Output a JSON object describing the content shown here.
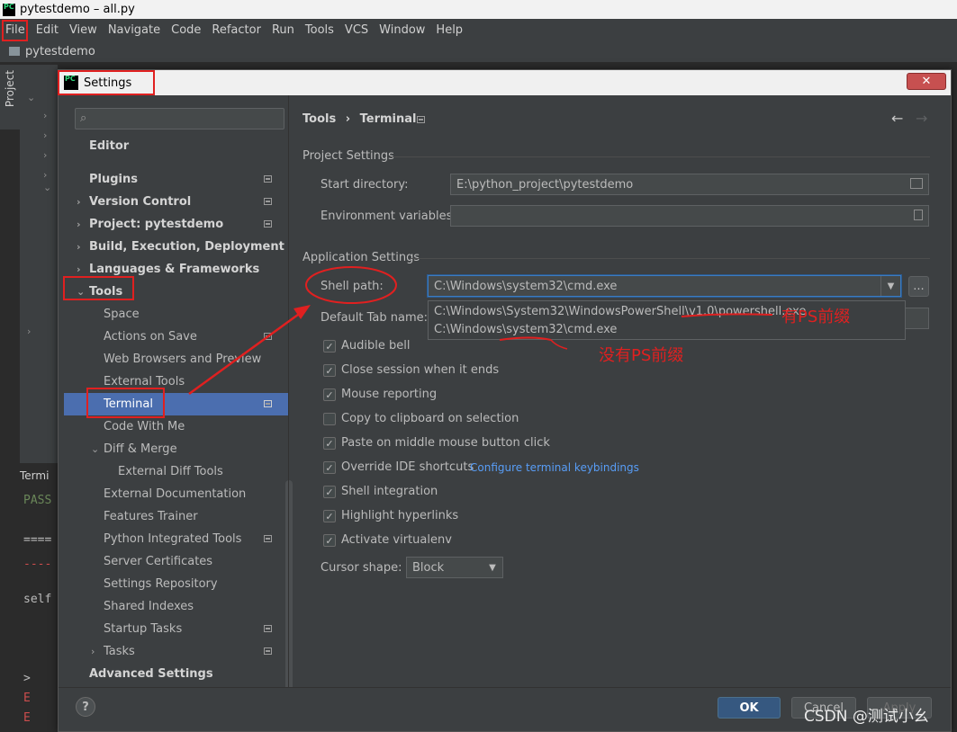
{
  "window": {
    "title": "pytestdemo – all.py",
    "logo": "PC"
  },
  "menu": [
    "File",
    "Edit",
    "View",
    "Navigate",
    "Code",
    "Refactor",
    "Run",
    "Tools",
    "VCS",
    "Window",
    "Help"
  ],
  "navbar": {
    "project": "pytestdemo"
  },
  "tool_window": {
    "project_tab": "Project",
    "terminal_tab": "Termi",
    "console_lines": [
      "PASS",
      "====",
      "----",
      "self",
      ">",
      "E",
      "E"
    ]
  },
  "dialog": {
    "title": "Settings",
    "close_label": "✕",
    "search_placeholder": "",
    "nav": [
      {
        "label": "Editor",
        "bold": true
      },
      {
        "label": "Plugins",
        "bold": true
      },
      {
        "label": "Version Control",
        "bold": true
      },
      {
        "label": "Project: pytestdemo",
        "bold": true
      },
      {
        "label": "Build, Execution, Deployment",
        "bold": true
      },
      {
        "label": "Languages & Frameworks",
        "bold": true
      },
      {
        "label": "Tools",
        "bold": true
      },
      {
        "label": "Space"
      },
      {
        "label": "Actions on Save"
      },
      {
        "label": "Web Browsers and Preview"
      },
      {
        "label": "External Tools"
      },
      {
        "label": "Terminal",
        "selected": true
      },
      {
        "label": "Code With Me"
      },
      {
        "label": "Diff & Merge"
      },
      {
        "label": "External Diff Tools"
      },
      {
        "label": "External Documentation"
      },
      {
        "label": "Features Trainer"
      },
      {
        "label": "Python Integrated Tools"
      },
      {
        "label": "Server Certificates"
      },
      {
        "label": "Settings Repository"
      },
      {
        "label": "Shared Indexes"
      },
      {
        "label": "Startup Tasks"
      },
      {
        "label": "Tasks"
      },
      {
        "label": "Advanced Settings",
        "bold": true
      }
    ],
    "breadcrumb": {
      "parent": "Tools",
      "separator": "›",
      "current": "Terminal"
    },
    "back_icon": "←",
    "forward_icon": "→",
    "project_settings": {
      "heading": "Project Settings",
      "start_directory_label": "Start directory:",
      "start_directory_value": "E:\\python_project\\pytestdemo",
      "env_vars_label": "Environment variables:",
      "env_vars_value": ""
    },
    "app_settings": {
      "heading": "Application Settings",
      "shell_path_label": "Shell path:",
      "shell_path_value": "C:\\Windows\\system32\\cmd.exe",
      "shell_options": [
        "C:\\Windows\\System32\\WindowsPowerShell\\v1.0\\powershell.exe",
        "C:\\Windows\\system32\\cmd.exe"
      ],
      "browse_label": "...",
      "default_tab_label": "Default Tab name:",
      "checkboxes": [
        {
          "label": "Audible bell",
          "checked": true
        },
        {
          "label": "Close session when it ends",
          "checked": true
        },
        {
          "label": "Mouse reporting",
          "checked": true
        },
        {
          "label": "Copy to clipboard on selection",
          "checked": false
        },
        {
          "label": "Paste on middle mouse button click",
          "checked": true
        },
        {
          "label": "Override IDE shortcuts",
          "checked": true
        },
        {
          "label": "Shell integration",
          "checked": true
        },
        {
          "label": "Highlight hyperlinks",
          "checked": true
        },
        {
          "label": "Activate virtualenv",
          "checked": true
        }
      ],
      "configure_link": "Configure terminal keybindings",
      "cursor_shape_label": "Cursor shape:",
      "cursor_shape_value": "Block"
    },
    "buttons": {
      "help": "?",
      "ok": "OK",
      "cancel": "Cancel",
      "apply": "Apply"
    }
  },
  "annotations": {
    "with_ps": "有PS前缀",
    "without_ps": "没有PS前缀",
    "accent": "#e02020"
  },
  "watermark": "CSDN @测试小幺"
}
